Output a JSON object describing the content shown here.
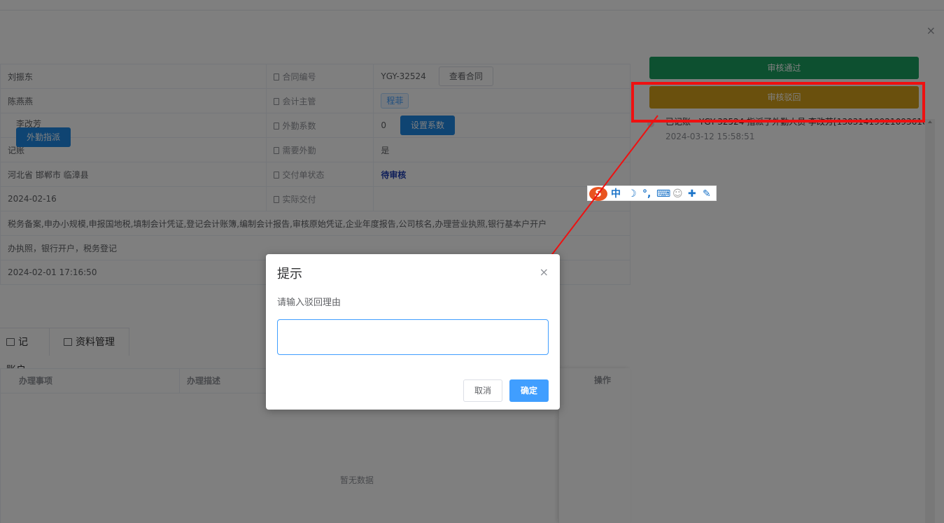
{
  "drawer": {
    "close": "×"
  },
  "info": {
    "rows": [
      {
        "left": "刘振东",
        "label": "合同编号",
        "value": "YGY-32524",
        "button": "查看合同"
      },
      {
        "left": "陈燕燕",
        "label": "会计主管",
        "tag": "程菲"
      },
      {
        "left": "李改芳",
        "left_button": "外勤指派",
        "label": "外勤系数",
        "value": "0",
        "button": "设置系数"
      },
      {
        "left": "记账",
        "label": "需要外勤",
        "value": "是"
      },
      {
        "left": "河北省 邯郸市 临漳县",
        "label": "交付单状态",
        "value": "待审核"
      },
      {
        "left": "2024-02-16",
        "label": "实际交付",
        "value": ""
      },
      {
        "full": "税务备案,申办小规模,申报国地税,填制会计凭证,登记会计账簿,编制会计报告,审核原始凭证,企业年度报告,公司核名,办理营业执照,银行基本户开户"
      },
      {
        "full": "办执照，银行开户，税务登记"
      },
      {
        "full": "2024-02-01 17:16:50"
      }
    ]
  },
  "tabs": [
    "记账户",
    "资料管理"
  ],
  "grid": {
    "columns": [
      "办理事项",
      "办理描述",
      "操作"
    ],
    "empty_text": "暂无数据"
  },
  "review": {
    "approve_label": "审核通过",
    "reject_label": "审核驳回",
    "timeline_text": "已记账 - YGY-32524 指派了外勤人员 李改芳[13031419921093610]",
    "timeline_time": "2024-03-12 15:58:51"
  },
  "ime": {
    "logo": "S",
    "mode": "中",
    "moon": "☽",
    "punct": "°,",
    "keyboard": "⌨",
    "user": "☺",
    "skin": "✚",
    "tool": "✎"
  },
  "modal": {
    "title": "提示",
    "close": "×",
    "message": "请输入驳回理由",
    "input_value": "",
    "cancel_label": "取消",
    "confirm_label": "确定"
  },
  "colors": {
    "approve": "#1aa060",
    "reject": "#d4a01a",
    "primary": "#409eff",
    "highlight": "#ee1111"
  }
}
